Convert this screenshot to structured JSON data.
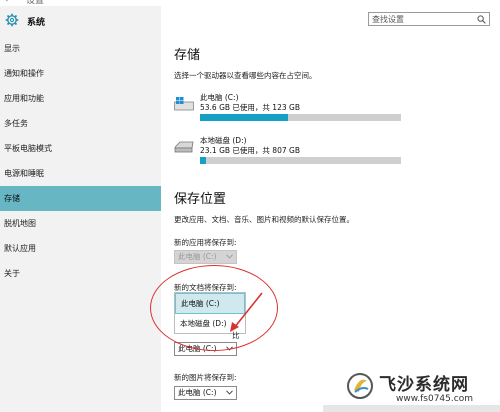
{
  "window": {
    "title": "设置",
    "back_glyph": "‹",
    "minimize_glyph": "—"
  },
  "sidebar": {
    "title": "系统",
    "items": [
      {
        "label": "显示"
      },
      {
        "label": "通知和操作"
      },
      {
        "label": "应用和功能"
      },
      {
        "label": "多任务"
      },
      {
        "label": "平板电脑模式"
      },
      {
        "label": "电源和睡眠"
      },
      {
        "label": "存储",
        "active": true
      },
      {
        "label": "脱机地图"
      },
      {
        "label": "默认应用"
      },
      {
        "label": "关于"
      }
    ]
  },
  "search": {
    "placeholder": "查找设置"
  },
  "storage": {
    "heading": "存储",
    "description": "选择一个驱动器以查看哪些内容在占空间。",
    "drives": [
      {
        "name": "此电脑 (C:)",
        "usage": "53.6 GB 已使用，共 123 GB",
        "used_fraction": 0.436,
        "icon": "windows-drive-icon"
      },
      {
        "name": "本地磁盘 (D:)",
        "usage": "23.1 GB 已使用，共 807 GB",
        "used_fraction": 0.029,
        "icon": "hard-drive-icon"
      }
    ]
  },
  "save_locations": {
    "heading": "保存位置",
    "description": "更改应用、文档、音乐、图片和视频的默认保存位置。",
    "apps_label": "新的应用将保存到:",
    "apps_value": "此电脑 (C:)",
    "docs_label": "新的文档将保存到:",
    "docs_options": [
      "此电脑 (C:)",
      "本地磁盘 (D:)"
    ],
    "docs_selected": "此电脑 (C:)",
    "music_label_partial": "比",
    "music_value": "此电脑 (C:)",
    "pictures_label": "新的图片将保存到:",
    "pictures_value": "此电脑 (C:)"
  },
  "annotation_color": "#d9312f",
  "accent_color": "#17a0c6",
  "watermark": {
    "title": "飞沙系统网",
    "url": "www.fs0745.com"
  }
}
